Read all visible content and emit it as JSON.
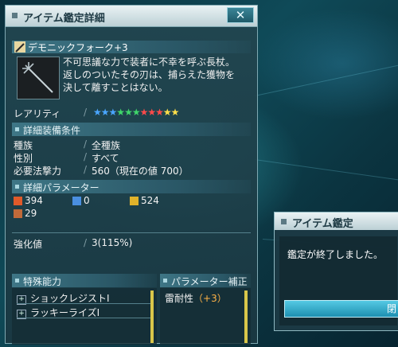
{
  "window": {
    "title": "アイテム鑑定詳細",
    "close_label": "✕"
  },
  "item": {
    "name": "デモニックフォーク+3",
    "icon": "wand-icon",
    "description": [
      "不可思議な力で装者に不幸を呼ぶ長杖。",
      "返しのついたその刃は、捕らえた獲物を",
      "決して離すことはない。"
    ]
  },
  "rarity": {
    "label": "レアリティ",
    "stars": 11,
    "star_colors": [
      "#4aa6ff",
      "#4aa6ff",
      "#4aa6ff",
      "#3fd66a",
      "#3fd66a",
      "#3fd66a",
      "#ff4a4a",
      "#ff4a4a",
      "#ff4a4a",
      "#ffe04a",
      "#ffe04a"
    ]
  },
  "requirements": {
    "header": "詳細装備条件",
    "rows": [
      {
        "label": "種族",
        "value": "全種族"
      },
      {
        "label": "性別",
        "value": "すべて"
      },
      {
        "label": "必要法撃力",
        "value": "560（現在の値 700）"
      }
    ]
  },
  "parameters": {
    "header": "詳細パラメーター",
    "stats": [
      {
        "icon": "attack-icon",
        "value": "394",
        "color": "#e05a2a"
      },
      {
        "icon": "defense-icon",
        "value": "0",
        "color": "#4a8fe0"
      },
      {
        "icon": "technique-icon",
        "value": "524",
        "color": "#e0b22a"
      },
      {
        "icon": "dexterity-icon",
        "value": "29",
        "color": "#c06a3a"
      }
    ]
  },
  "enhancement": {
    "label": "強化値",
    "value": "3(115%)"
  },
  "abilities": {
    "header": "特殊能力",
    "items": [
      "ショックレジストI",
      "ラッキーライズI"
    ]
  },
  "param_bonus": {
    "header": "パラメーター補正",
    "items": [
      {
        "label": "雷耐性",
        "value": "（+3）"
      }
    ]
  },
  "dialog": {
    "title": "アイテム鑑定",
    "message": "鑑定が終了しました。",
    "button_label": "閉"
  }
}
